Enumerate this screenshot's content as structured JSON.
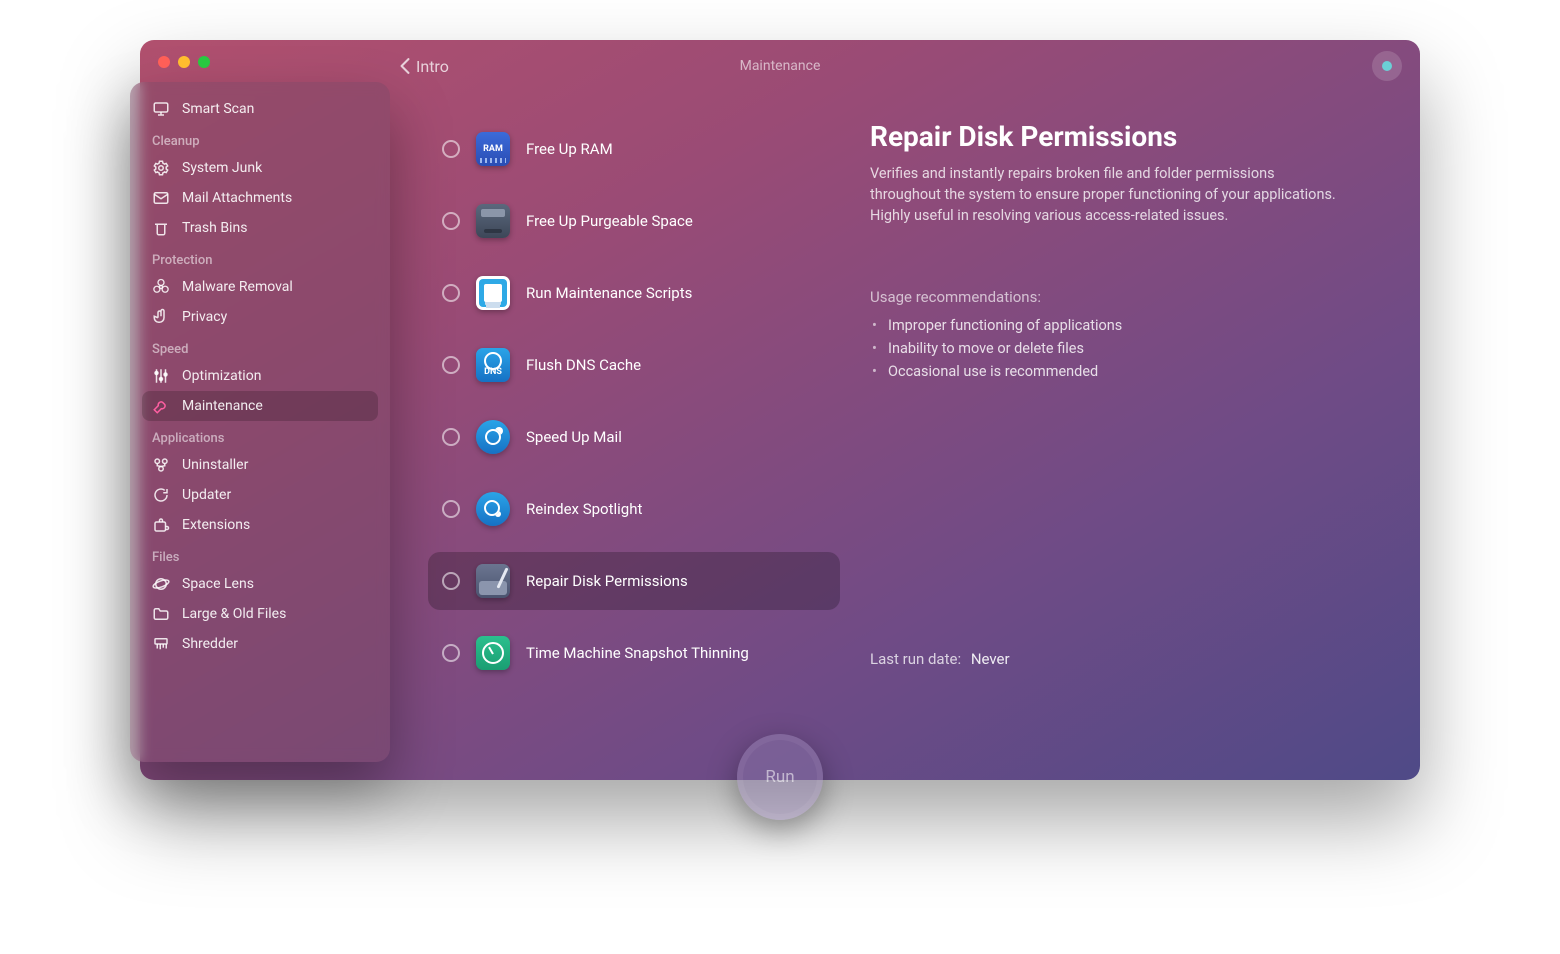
{
  "header": {
    "back_label": "Intro",
    "section_title": "Maintenance"
  },
  "sidebar": {
    "smart_scan": "Smart Scan",
    "groups": [
      {
        "title": "Cleanup",
        "items": [
          {
            "icon": "gear-icon",
            "label": "System Junk"
          },
          {
            "icon": "mail-icon",
            "label": "Mail Attachments"
          },
          {
            "icon": "trash-icon",
            "label": "Trash Bins"
          }
        ]
      },
      {
        "title": "Protection",
        "items": [
          {
            "icon": "biohazard-icon",
            "label": "Malware Removal"
          },
          {
            "icon": "hand-icon",
            "label": "Privacy"
          }
        ]
      },
      {
        "title": "Speed",
        "items": [
          {
            "icon": "sliders-icon",
            "label": "Optimization"
          },
          {
            "icon": "wrench-icon",
            "label": "Maintenance",
            "active": true
          }
        ]
      },
      {
        "title": "Applications",
        "items": [
          {
            "icon": "uninstall-icon",
            "label": "Uninstaller"
          },
          {
            "icon": "refresh-icon",
            "label": "Updater"
          },
          {
            "icon": "puzzle-icon",
            "label": "Extensions"
          }
        ]
      },
      {
        "title": "Files",
        "items": [
          {
            "icon": "planet-icon",
            "label": "Space Lens"
          },
          {
            "icon": "folder-icon",
            "label": "Large & Old Files"
          },
          {
            "icon": "shredder-icon",
            "label": "Shredder"
          }
        ]
      }
    ]
  },
  "tasks": [
    {
      "icon_class": "ti-ram",
      "icon_text": "RAM",
      "label": "Free Up RAM"
    },
    {
      "icon_class": "ti-purge",
      "icon_text": "",
      "label": "Free Up Purgeable Space"
    },
    {
      "icon_class": "ti-scripts",
      "icon_text": "",
      "label": "Run Maintenance Scripts"
    },
    {
      "icon_class": "ti-dns",
      "icon_text": "DNS",
      "label": "Flush DNS Cache"
    },
    {
      "icon_class": "ti-mail",
      "icon_text": "",
      "label": "Speed Up Mail"
    },
    {
      "icon_class": "ti-spot",
      "icon_text": "",
      "label": "Reindex Spotlight"
    },
    {
      "icon_class": "ti-repair",
      "icon_text": "",
      "label": "Repair Disk Permissions",
      "selected": true
    },
    {
      "icon_class": "ti-tm",
      "icon_text": "",
      "label": "Time Machine Snapshot Thinning"
    }
  ],
  "detail": {
    "title": "Repair Disk Permissions",
    "description": "Verifies and instantly repairs broken file and folder permissions throughout the system to ensure proper functioning of your applications. Highly useful in resolving various access-related issues.",
    "usage_heading": "Usage recommendations:",
    "bullets": [
      "Improper functioning of applications",
      "Inability to move or delete files",
      "Occasional use is recommended"
    ],
    "last_run_label": "Last run date:",
    "last_run_value": "Never",
    "run_label": "Run"
  }
}
